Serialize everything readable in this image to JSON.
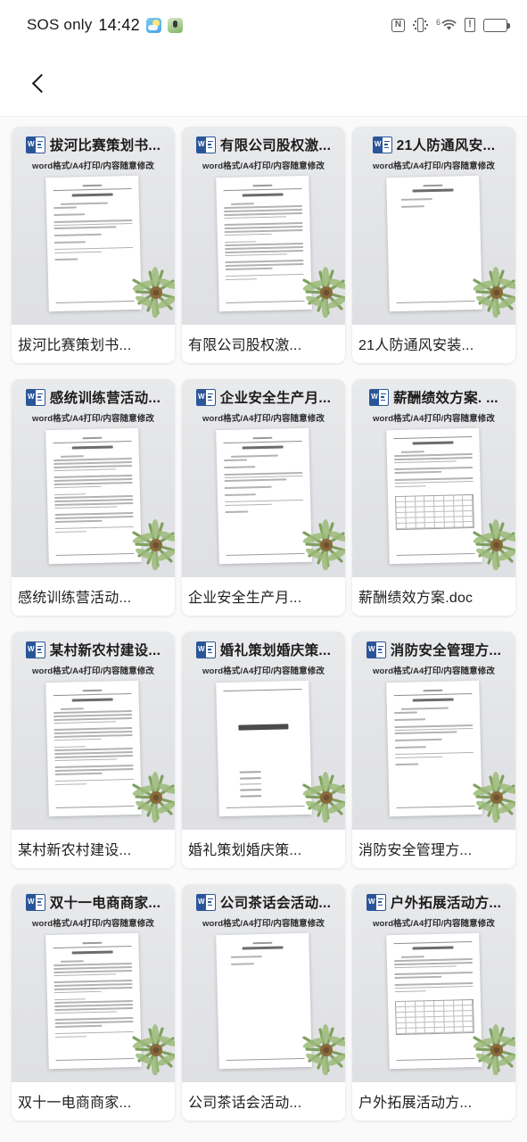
{
  "statusbar": {
    "carrier": "SOS only",
    "time": "14:42",
    "left_app_icons": [
      "weather-app-icon",
      "game-app-icon"
    ],
    "right_icons": [
      "nfc-icon",
      "vibrate-icon",
      "wifi-icon",
      "alert-icon",
      "battery-icon"
    ],
    "wifi_generation": "6"
  },
  "appbar": {
    "back_icon": "chevron-left-icon"
  },
  "theme": {
    "page_background": "#ffffff",
    "grid_background": "#fafafa",
    "card_preview_background": "#e6e7ea",
    "word_blue": "#2a5699",
    "text_primary": "#1c1c1c"
  },
  "common": {
    "subtitle": "word格式/A4打印/内容随意修改",
    "file_type_icon": "word-icon",
    "decoration_icon": "plant-leaf-icon"
  },
  "documents": [
    {
      "title": "拔河比赛策划书...",
      "subtitle": "word格式/A4打印/内容随意修改",
      "label": "拔河比赛策划书...",
      "thumb": "text"
    },
    {
      "title": "有限公司股权激...",
      "subtitle": "word格式/A4打印/内容随意修改",
      "label": "有限公司股权激...",
      "thumb": "dense"
    },
    {
      "title": "21人防通风安...",
      "subtitle": "word格式/A4打印/内容随意修改",
      "label": "21人防通风安装...",
      "thumb": "sparse"
    },
    {
      "title": "感统训练营活动...",
      "subtitle": "word格式/A4打印/内容随意修改",
      "label": "感统训练营活动...",
      "thumb": "dense"
    },
    {
      "title": "企业安全生产月...",
      "subtitle": "word格式/A4打印/内容随意修改",
      "label": "企业安全生产月...",
      "thumb": "text"
    },
    {
      "title": "薪酬绩效方案. ...",
      "subtitle": "word格式/A4打印/内容随意修改",
      "label": "薪酬绩效方案.doc",
      "thumb": "table"
    },
    {
      "title": "某村新农村建设...",
      "subtitle": "word格式/A4打印/内容随意修改",
      "label": "某村新农村建设...",
      "thumb": "dense"
    },
    {
      "title": "婚礼策划婚庆策...",
      "subtitle": "word格式/A4打印/内容随意修改",
      "label": "婚礼策划婚庆策...",
      "thumb": "cover"
    },
    {
      "title": "消防安全管理方...",
      "subtitle": "word格式/A4打印/内容随意修改",
      "label": "消防安全管理方...",
      "thumb": "text"
    },
    {
      "title": "双十一电商商家...",
      "subtitle": "word格式/A4打印/内容随意修改",
      "label": "双十一电商商家...",
      "thumb": "dense"
    },
    {
      "title": "公司茶话会活动...",
      "subtitle": "word格式/A4打印/内容随意修改",
      "label": "公司茶话会活动...",
      "thumb": "sparse"
    },
    {
      "title": "户外拓展活动方...",
      "subtitle": "word格式/A4打印/内容随意修改",
      "label": "户外拓展活动方...",
      "thumb": "table"
    }
  ]
}
